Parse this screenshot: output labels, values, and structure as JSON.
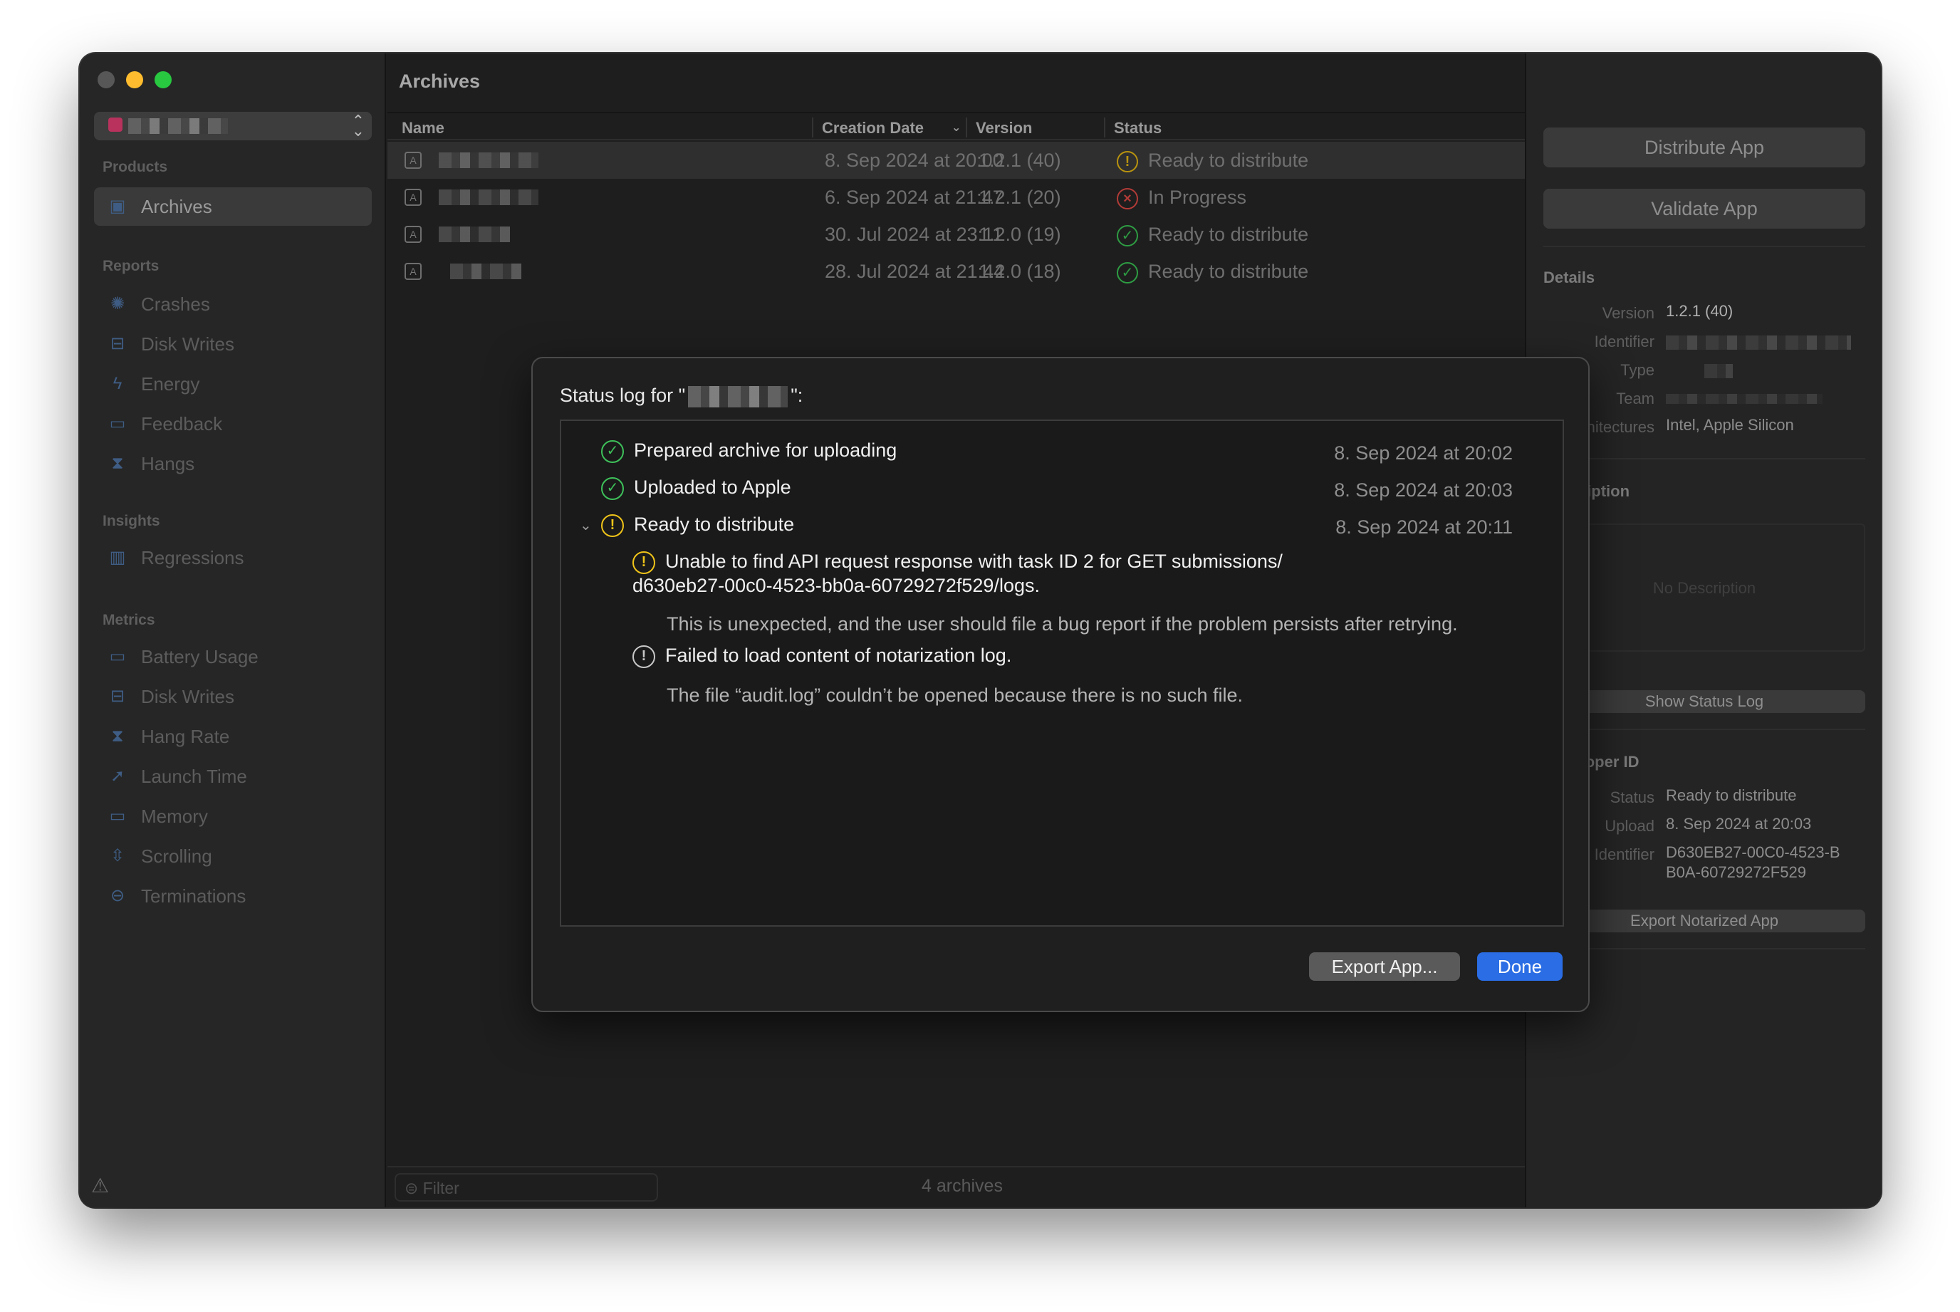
{
  "window": {
    "title": "Archives"
  },
  "sidebar": {
    "sections": [
      {
        "label": "Products",
        "items": [
          {
            "label": "Archives",
            "icon": "archive-icon",
            "active": true
          }
        ]
      },
      {
        "label": "Reports",
        "items": [
          {
            "label": "Crashes",
            "icon": "gear-icon"
          },
          {
            "label": "Disk Writes",
            "icon": "disk-icon"
          },
          {
            "label": "Energy",
            "icon": "bolt-icon"
          },
          {
            "label": "Feedback",
            "icon": "speech-bubble-icon"
          },
          {
            "label": "Hangs",
            "icon": "hourglass-icon"
          }
        ]
      },
      {
        "label": "Insights",
        "items": [
          {
            "label": "Regressions",
            "icon": "bar-chart-icon"
          }
        ]
      },
      {
        "label": "Metrics",
        "items": [
          {
            "label": "Battery Usage",
            "icon": "battery-icon"
          },
          {
            "label": "Disk Writes",
            "icon": "disk-icon"
          },
          {
            "label": "Hang Rate",
            "icon": "hourglass-icon"
          },
          {
            "label": "Launch Time",
            "icon": "rocket-icon"
          },
          {
            "label": "Memory",
            "icon": "memory-icon"
          },
          {
            "label": "Scrolling",
            "icon": "scroll-icon"
          },
          {
            "label": "Terminations",
            "icon": "stop-icon"
          }
        ]
      }
    ]
  },
  "table": {
    "columns": {
      "name": "Name",
      "creation_date": "Creation Date",
      "version": "Version",
      "status": "Status"
    },
    "rows": [
      {
        "date": "8. Sep 2024 at 20:00",
        "version": "1.2.1 (40)",
        "status": "Ready to distribute",
        "status_kind": "warn"
      },
      {
        "date": "6. Sep 2024 at 21:47",
        "version": "1.2.1 (20)",
        "status": "In Progress",
        "status_kind": "error"
      },
      {
        "date": "30. Jul 2024 at 23:11",
        "version": "1.2.0 (19)",
        "status": "Ready to distribute",
        "status_kind": "ok"
      },
      {
        "date": "28. Jul 2024 at 21:44",
        "version": "1.2.0 (18)",
        "status": "Ready to distribute",
        "status_kind": "ok"
      }
    ],
    "filter_placeholder": "Filter",
    "count": "4 archives"
  },
  "inspector": {
    "distribute_button": "Distribute App",
    "validate_button": "Validate App",
    "details_label": "Details",
    "details": {
      "version_label": "Version",
      "version": "1.2.1 (40)",
      "identifier_label": "Identifier",
      "type_label": "Type",
      "team_label": "Team",
      "architectures_label": "Architectures",
      "architectures": "Intel, Apple Silicon"
    },
    "description_label": "Description",
    "description_placeholder": "No Description",
    "show_status_log_button": "Show Status Log",
    "developer_id_label": "Developer ID",
    "developer_id": {
      "status_label": "Status",
      "status": "Ready to distribute",
      "upload_label": "Upload",
      "upload": "8. Sep 2024 at 20:03",
      "identifier_label": "Identifier",
      "identifier_line1": "D630EB27-00C0-4523-B",
      "identifier_line2": "B0A-60729272F529"
    },
    "export_notarized_button": "Export Notarized App"
  },
  "sheet": {
    "title_prefix": "Status log for \"",
    "title_suffix": "\":",
    "entries": [
      {
        "text": "Prepared archive for uploading",
        "date": "8. Sep 2024 at 20:02",
        "kind": "ok"
      },
      {
        "text": "Uploaded to Apple",
        "date": "8. Sep 2024 at 20:03",
        "kind": "ok"
      },
      {
        "text": "Ready to distribute",
        "date": "8. Sep 2024 at 20:11",
        "kind": "warn"
      }
    ],
    "sub_warning_line1": "Unable to find API request response with task ID 2 for GET submissions/",
    "sub_warning_line2": "d630eb27-00c0-4523-bb0a-60729272f529/logs.",
    "sub_warning_note": "This is unexpected, and the user should file a bug report if the problem persists after retrying.",
    "sub_info": "Failed to load content of notarization log.",
    "sub_info_note": "The file “audit.log” couldn’t be opened because there is no such file.",
    "export_button": "Export App...",
    "done_button": "Done"
  },
  "colors": {
    "accent": "#2a6de4",
    "ok": "#3ec15a",
    "warn": "#f0c419",
    "error": "#b23b37"
  }
}
